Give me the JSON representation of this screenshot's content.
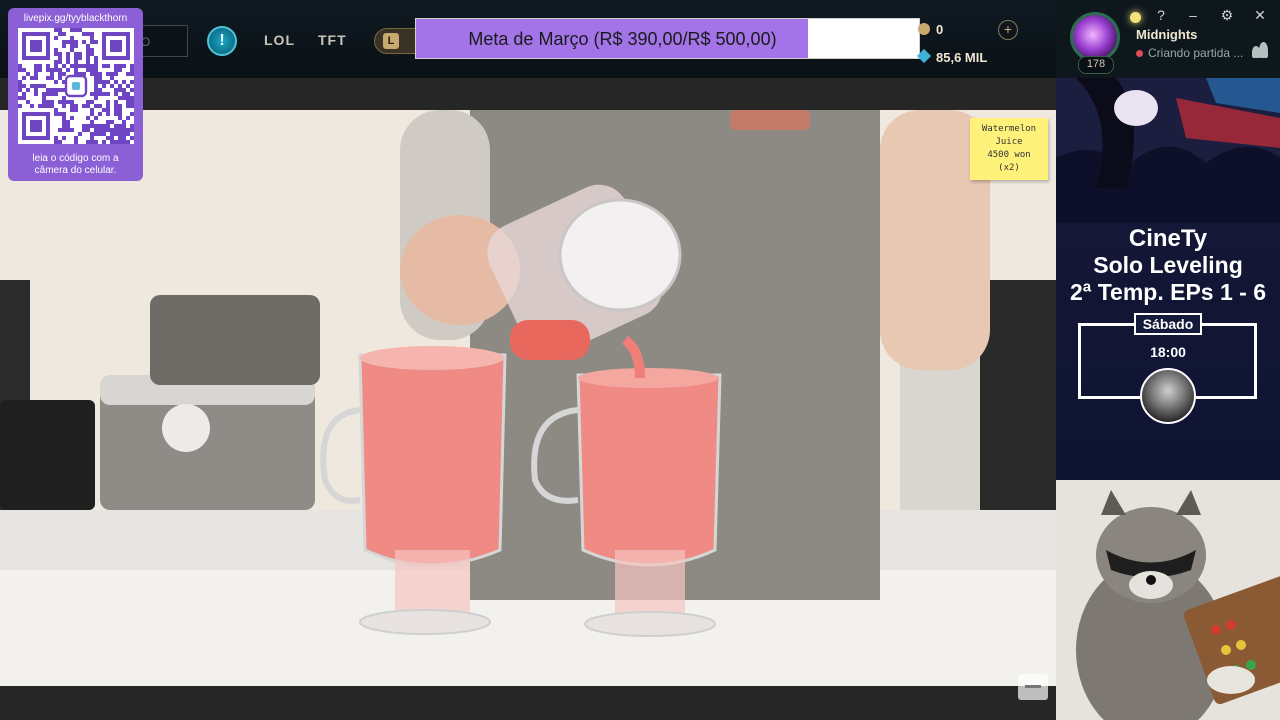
{
  "qr_overlay": {
    "url": "livepix.gg/tyyblackthorn",
    "hint_line1": "leia o código com a",
    "hint_line2": "câmera do celular."
  },
  "top_bar": {
    "search_placeholder": "O",
    "nav": [
      "LOL",
      "TFT"
    ],
    "lol_badge": "L"
  },
  "goal": {
    "label": "Meta de Março (R$ 390,00/R$ 500,00)",
    "current": 390,
    "target": 500,
    "progress": 0.78,
    "fill_color": "#a274e8"
  },
  "currency": {
    "riot_points": "0",
    "blue_essence": "85,6 MIL"
  },
  "profile": {
    "name": "Midnights",
    "status": "Criando partida ...",
    "level": "178",
    "window_controls": [
      "?",
      "–",
      "⚙",
      "✕"
    ]
  },
  "video": {
    "sticky_note": [
      "Watermelon",
      "Juice",
      "4500 won",
      "(x2)"
    ]
  },
  "promo": {
    "brand": "CineTy",
    "line1": "Solo Leveling",
    "line2": "2ª Temp. EPs 1 - 6",
    "day": "Sábado",
    "time": "18:00"
  },
  "colors": {
    "accent_purple": "#8b5fd6",
    "gold": "#c8aa6e",
    "promo_bg": "#131735"
  }
}
